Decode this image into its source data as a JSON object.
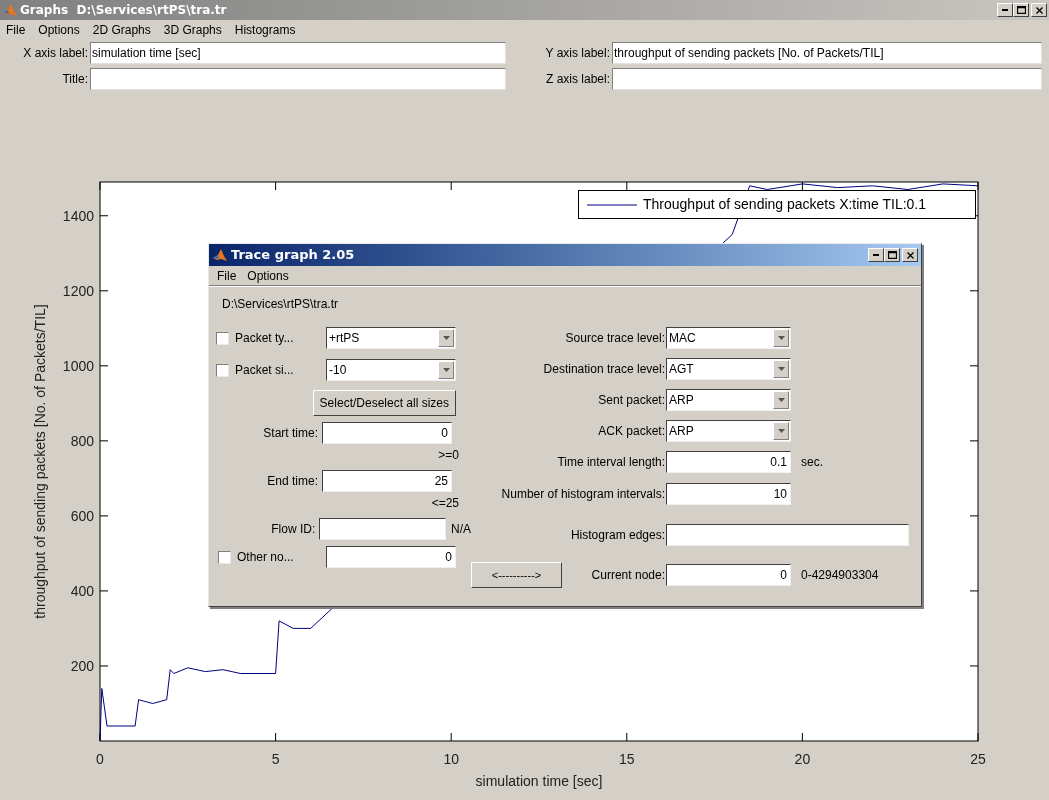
{
  "window": {
    "title": "Graphs  D:\\Services\\rtPS\\tra.tr"
  },
  "menu": [
    "File",
    "Options",
    "2D Graphs",
    "3D Graphs",
    "Histograms"
  ],
  "fields": [
    {
      "label": "X axis label:",
      "value": "simulation time [sec]"
    },
    {
      "label": "Y axis label:",
      "value": "throughput of sending packets [No. of Packets/TIL]"
    },
    {
      "label": "Title:"
    },
    {
      "label": "Z axis label:"
    }
  ],
  "plot": {
    "chart_data": {
      "type": "line",
      "xlabel": "simulation time [sec]",
      "ylabel": "throughput of sending packets [No. of Packets/TIL]",
      "x": [
        0,
        0.05,
        0.2,
        0.5,
        1,
        1.1,
        1.5,
        1.9,
        2,
        2.1,
        2.5,
        3,
        3.5,
        4,
        4.5,
        5,
        5.1,
        5.5,
        6,
        18,
        18.5,
        19,
        20,
        21,
        22,
        23,
        24,
        25
      ],
      "series": [
        {
          "name": "Throughput of sending packets X:time TIL:0.1",
          "color": "#000080",
          "values": [
            0,
            140,
            40,
            40,
            40,
            110,
            100,
            110,
            190,
            180,
            195,
            185,
            190,
            180,
            180,
            180,
            320,
            300,
            300,
            1350,
            1480,
            1470,
            1485,
            1475,
            1480,
            1470,
            1485,
            1480
          ]
        }
      ],
      "xlim": [
        0,
        25
      ],
      "ylim": [
        0,
        1490
      ],
      "xticks": [
        0,
        5,
        10,
        15,
        20,
        25
      ],
      "yticks": [
        200,
        400,
        600,
        800,
        1000,
        1200,
        1400
      ]
    }
  },
  "dialog": {
    "title": "Trace graph 2.05",
    "menu": [
      "File",
      "Options"
    ],
    "path": "D:\\Services\\rtPS\\tra.tr",
    "left": [
      {
        "kind": "check_select",
        "label": "Packet ty...",
        "checked": false,
        "value": "+rtPS"
      },
      {
        "kind": "check_select",
        "label": "Packet si...",
        "checked": false,
        "value": "-10"
      },
      {
        "kind": "button",
        "label": "Select/Deselect all sizes"
      },
      {
        "kind": "input",
        "label": "Start time:",
        "value": "0"
      },
      {
        "kind": "hint",
        "text": ">=0"
      },
      {
        "kind": "input",
        "label": "End time:",
        "value": "25"
      },
      {
        "kind": "hint",
        "text": "<=25"
      },
      {
        "kind": "input",
        "label": "Flow ID:",
        "suffix": "N/A"
      },
      {
        "kind": "check_input",
        "label": "Other no...",
        "checked": false,
        "value": "0"
      }
    ],
    "right": [
      {
        "kind": "select",
        "label": "Source trace level:",
        "value": "MAC"
      },
      {
        "kind": "select",
        "label": "Destination trace level:",
        "value": "AGT"
      },
      {
        "kind": "select",
        "label": "Sent packet:",
        "value": "ARP"
      },
      {
        "kind": "select",
        "label": "ACK packet:",
        "value": "ARP"
      },
      {
        "kind": "input",
        "label": "Time interval length:",
        "value": "0.1",
        "suffix": "sec."
      },
      {
        "kind": "input",
        "label": "Number of histogram intervals:",
        "value": "10"
      },
      {
        "kind": "wide_input",
        "label": "Histogram edges:"
      },
      {
        "kind": "node_input",
        "button": "<---------->",
        "label": "Current node:",
        "value": "0",
        "suffix": "0-4294903304"
      }
    ]
  }
}
